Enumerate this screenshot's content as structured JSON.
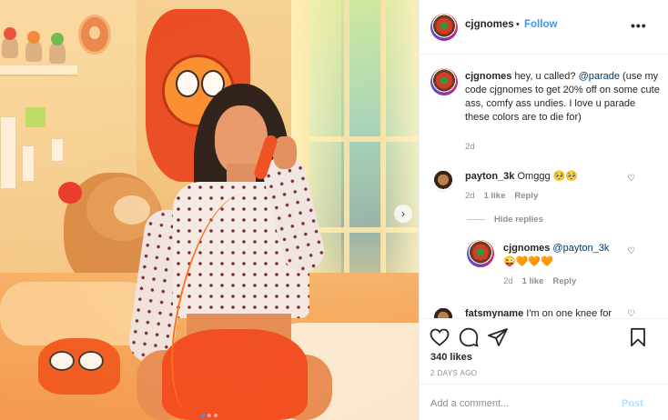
{
  "header": {
    "username": "cjgnomes",
    "separator": "•",
    "follow_label": "Follow",
    "more_label": "•••"
  },
  "caption": {
    "username": "cjgnomes",
    "text_before": "hey, u called?",
    "mention": "@parade",
    "text_after": "(use my code cjgnomes to get 20% off on some cute ass, comfy ass undies. I love u parade these colors are to die for)",
    "time": "2d"
  },
  "comments": [
    {
      "username": "payton_3k",
      "text": "Omggg 🥺🥺",
      "time": "2d",
      "likes": "1 like",
      "reply_label": "Reply"
    },
    {
      "username": "fatsmyname",
      "text": "I'm on one knee for"
    }
  ],
  "hide_replies_label": "Hide replies",
  "reply": {
    "username": "cjgnomes",
    "mention": "@payton_3k",
    "text": "😜🧡🧡🧡",
    "time": "2d",
    "likes": "1 like",
    "reply_label": "Reply"
  },
  "actions": {
    "likes_text": "340 likes",
    "posted_ago": "2 DAYS AGO"
  },
  "add_comment": {
    "placeholder": "Add a comment...",
    "post_label": "Post"
  },
  "carousel": {
    "next_label": "›",
    "slide_count": 3,
    "active_index": 0
  },
  "colors": {
    "accent": "#3897f0",
    "post_disabled": "#b2dffc",
    "muted": "#8e8e8e",
    "text": "#262626"
  }
}
